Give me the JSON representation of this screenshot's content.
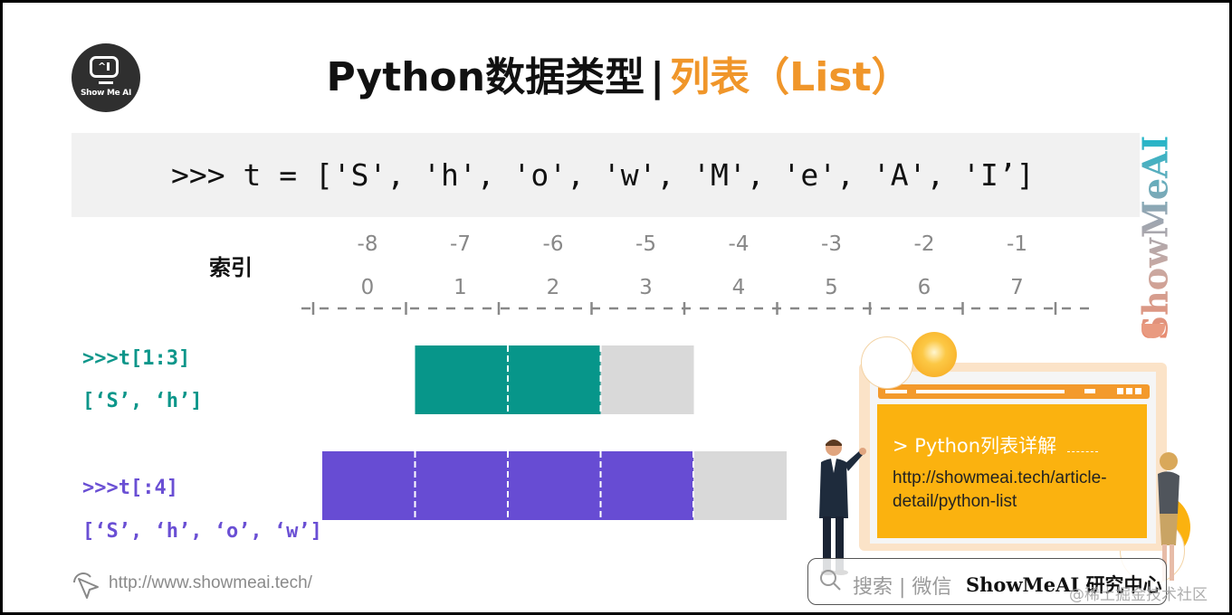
{
  "logo": {
    "text": "Show Me AI",
    "screen_glyph": "^"
  },
  "title": {
    "main": "Python数据类型",
    "separator": "|",
    "highlight": "列表（List）"
  },
  "code_banner": {
    "code": ">>> t = ['S', 'h', 'o', 'w', 'M', 'e', 'A', 'I’]"
  },
  "watermark_vertical": "ShowMeAI",
  "index": {
    "label": "索引",
    "negative": [
      "-8",
      "-7",
      "-6",
      "-5",
      "-4",
      "-3",
      "-2",
      "-1"
    ],
    "positive": [
      "0",
      "1",
      "2",
      "3",
      "4",
      "5",
      "6",
      "7"
    ]
  },
  "examples": [
    {
      "expr": ">>>t[1:3]",
      "result": "[‘S’, ‘h’]",
      "color": "#07968a",
      "start": 1,
      "stop": 3,
      "shown_until": 4
    },
    {
      "expr": ">>>t[:4]",
      "result": "[‘S’, ‘h’, ‘o’, ‘w’]",
      "color": "#674cd3",
      "start": 0,
      "stop": 4,
      "shown_until": 5
    }
  ],
  "colors": {
    "teal": "#07968a",
    "purple": "#674cd3",
    "unselected": "#d9d9d9",
    "title_orange": "#f0962a",
    "promo_orange": "#fbb20f"
  },
  "promo": {
    "title": "> Python列表详解",
    "url": "http://showmeai.tech/article-detail/python-list"
  },
  "search": {
    "hint": "搜索 | 微信",
    "brand": "ShowMeAI",
    "brand_cn": "研究中心"
  },
  "watermark_juejin": "@稀土掘金技术社区",
  "footer": {
    "url": "http://www.showmeai.tech/"
  }
}
